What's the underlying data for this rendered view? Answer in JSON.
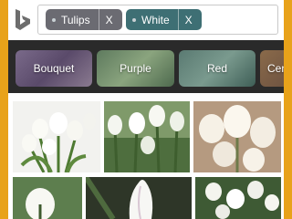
{
  "search": {
    "chips": [
      {
        "label": "Tulips",
        "remove": "X",
        "color": "#6b6b72"
      },
      {
        "label": "White",
        "remove": "X",
        "color": "#3e6f74"
      }
    ]
  },
  "categories": [
    {
      "label": "Bouquet"
    },
    {
      "label": "Purple"
    },
    {
      "label": "Red"
    },
    {
      "label": "Cen"
    }
  ],
  "images": [
    {
      "name": "white tulips bouquet"
    },
    {
      "name": "white tulips in garden"
    },
    {
      "name": "white tulips cluster"
    },
    {
      "name": "white tulips on green"
    },
    {
      "name": "single white tulip"
    },
    {
      "name": "white tulip field"
    }
  ],
  "colors": {
    "frame": "#e8a21a",
    "strip": "#2a2a2a",
    "logo": "#6d6d6d"
  }
}
